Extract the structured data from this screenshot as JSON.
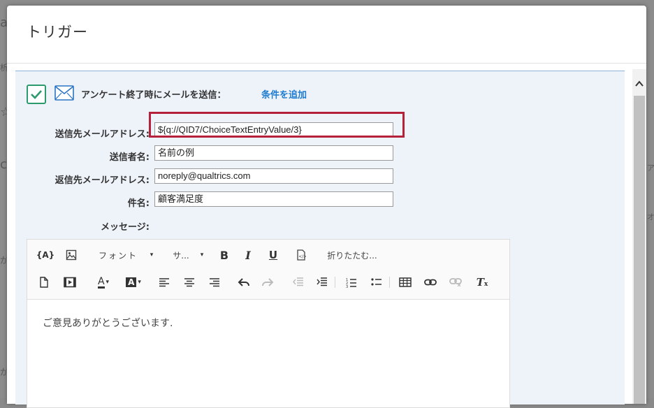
{
  "background": {
    "chars": [
      "a",
      "析",
      "☆",
      "ch",
      "が",
      "ア",
      "オ",
      "が"
    ]
  },
  "modal": {
    "title": "トリガー"
  },
  "trigger": {
    "checkbox_checked": true,
    "label": "アンケート終了時にメールを送信：",
    "add_condition": "条件を追加"
  },
  "fields": {
    "to_label": "送信先メールアドレス:",
    "to_value": "${q://QID7/ChoiceTextEntryValue/3}",
    "from_name_label": "送信者名:",
    "from_name_value": "名前の例",
    "reply_to_label": "返信先メールアドレス:",
    "reply_to_value": "noreply@qualtrics.com",
    "subject_label": "件名:",
    "subject_value": "顧客満足度",
    "message_label": "メッセージ:"
  },
  "toolbar": {
    "piped_text": "{A}",
    "font_label": "フォント",
    "size_label": "サ...",
    "bold": "B",
    "italic": "I",
    "underline": "U",
    "collapse_label": "折りたたむ..."
  },
  "editor": {
    "body_text": "ご意見ありがとうございます."
  },
  "colors": {
    "accent": "#1f7ccf",
    "check": "#2b9a6c",
    "highlight": "#b5203a"
  }
}
